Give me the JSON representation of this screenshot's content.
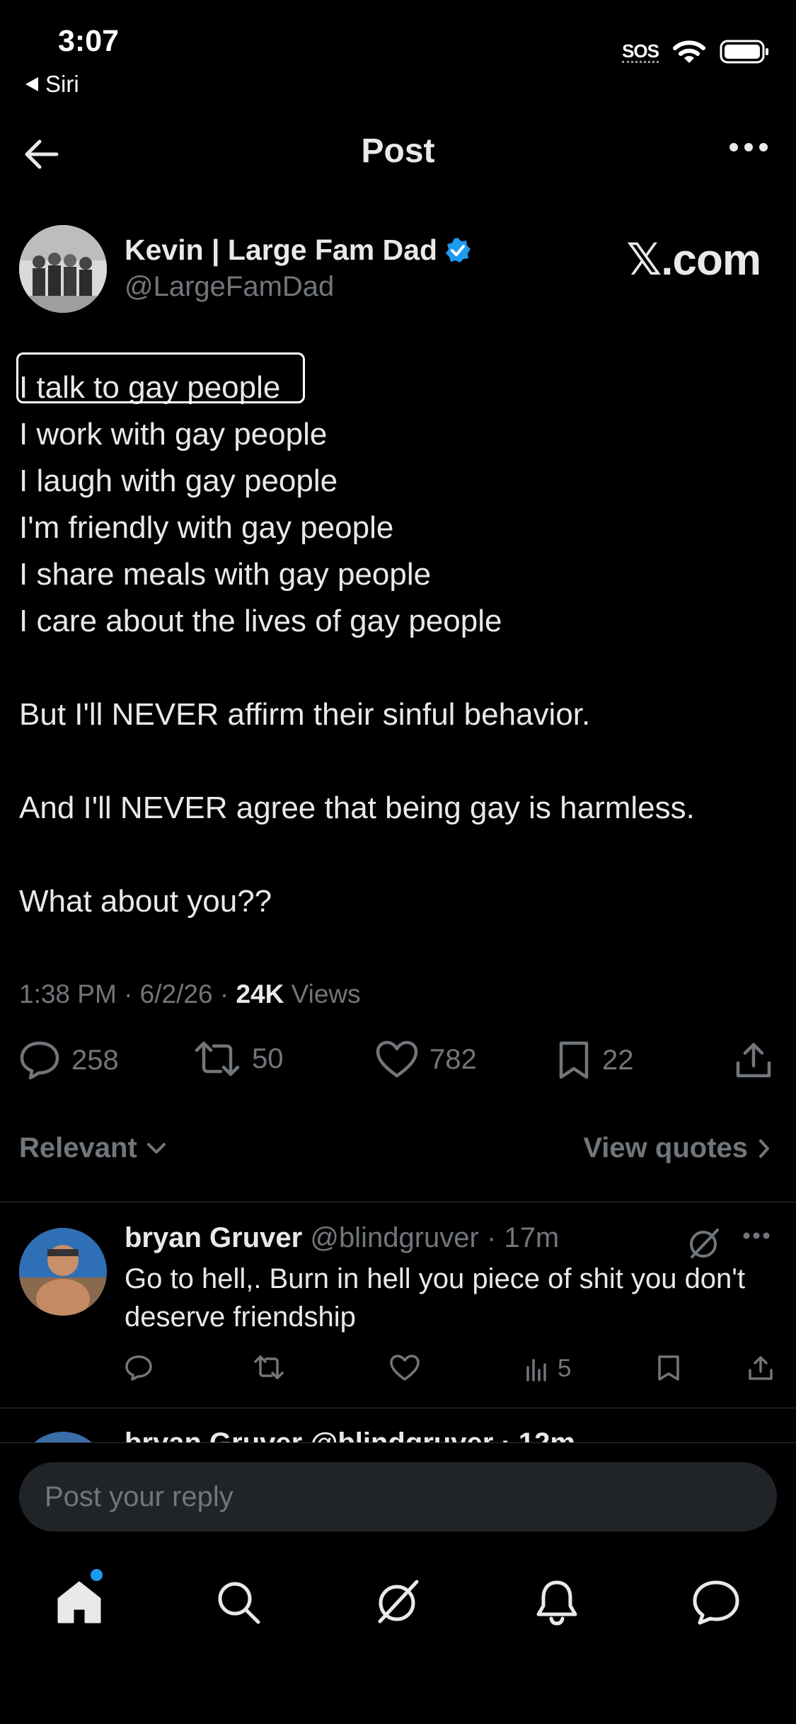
{
  "status_bar": {
    "time": "3:07",
    "back_label": "Siri",
    "sos": "SOS"
  },
  "header": {
    "title": "Post"
  },
  "post": {
    "author_name": "Kevin | Large Fam Dad",
    "author_handle": "@LargeFamDad",
    "brand_text": "𝕏.com",
    "lines": [
      "I talk to gay people",
      "I work with gay people",
      "I laugh with gay people",
      "I'm friendly with gay people",
      "I share meals with gay people",
      "I care about the lives of gay people",
      "But I'll NEVER affirm their sinful behavior.",
      "And I'll NEVER agree that being gay is harmless.",
      "What about you??"
    ],
    "timestamp": "1:38 PM · 6/2/26 · ",
    "views_count": "24K",
    "views_label": " Views",
    "replies": "258",
    "reposts": "50",
    "likes": "782",
    "bookmarks": "22"
  },
  "sort": {
    "relevant_label": "Relevant",
    "view_quotes_label": "View quotes"
  },
  "reply": {
    "name": "bryan Gruver",
    "meta": " @blindgruver · 17m",
    "text": "Go to hell,. Burn in hell you piece of shit you don't deserve friendship",
    "views": "5"
  },
  "peek_reply": {
    "text": "bryan Gruver @blindgruver · 12m"
  },
  "composer": {
    "placeholder": "Post your reply"
  },
  "colors": {
    "background": "#000000",
    "text": "#e7e9ea",
    "muted": "#71767b",
    "accent": "#1d9bf0",
    "input_bg": "#202327"
  },
  "icons": [
    "back-arrow-icon",
    "more-icon",
    "verified-icon",
    "reply-icon",
    "repost-icon",
    "like-icon",
    "bookmark-icon",
    "share-icon",
    "grok-icon",
    "views-icon",
    "home-icon",
    "search-icon",
    "notifications-icon",
    "messages-icon"
  ]
}
